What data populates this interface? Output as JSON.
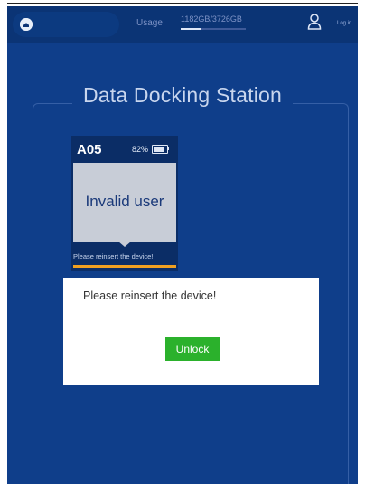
{
  "topbar": {
    "usage_label": "Usage",
    "usage_value": "1182GB/3726GB",
    "usage_fraction": 0.32,
    "login_label": "Log in",
    "home_icon": "robot-head-icon",
    "user_icon": "user-icon"
  },
  "main": {
    "title": "Data Docking Station"
  },
  "device": {
    "id": "A05",
    "battery_pct": "82%",
    "battery_level": 0.82,
    "screen_text": "Invalid user",
    "status_text": "Please reinsert the device!",
    "status_bar_color": "#f0a021"
  },
  "dialog": {
    "message": "Please reinsert the device!",
    "button_label": "Unlock",
    "button_color": "#2bb12c"
  },
  "colors": {
    "background": "#0f3e8a",
    "topbar": "#0b3475"
  }
}
